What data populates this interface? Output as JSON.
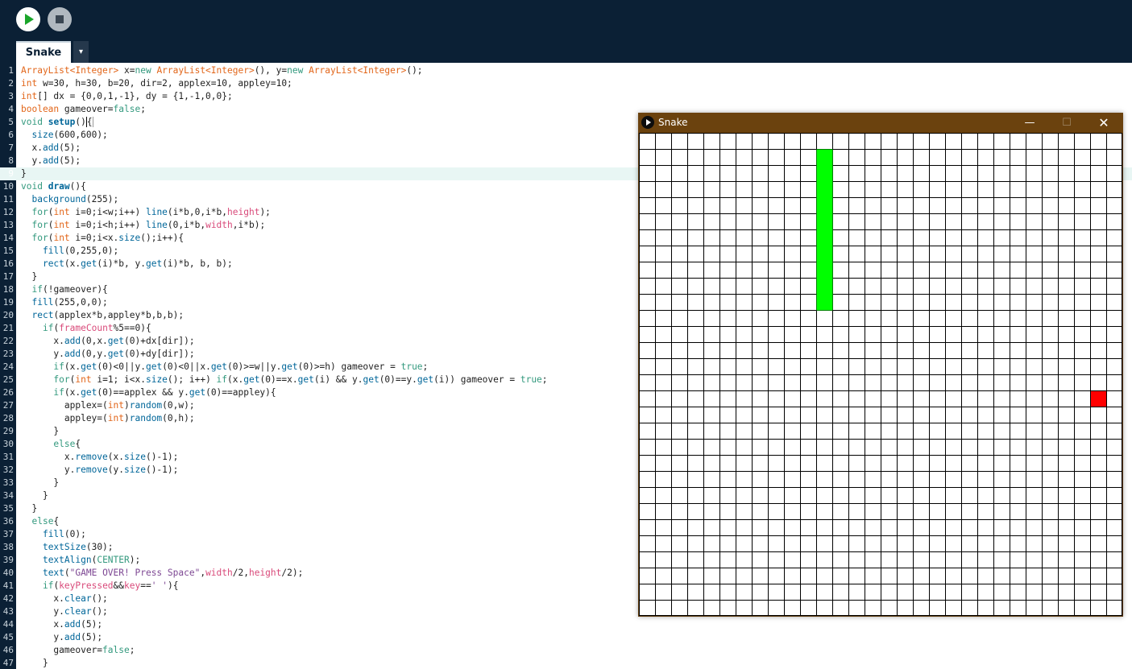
{
  "toolbar": {
    "run_icon": "play-icon",
    "stop_icon": "stop-icon"
  },
  "tabs": {
    "active": "Snake",
    "menu_glyph": "▾"
  },
  "editor": {
    "active_line": 9,
    "lines": [
      [
        [
          "ty",
          "ArrayList<Integer>"
        ],
        [
          "t",
          " x="
        ],
        [
          "kw",
          "new"
        ],
        [
          "t",
          " "
        ],
        [
          "ty",
          "ArrayList<Integer>"
        ],
        [
          "t",
          "(), y="
        ],
        [
          "kw",
          "new"
        ],
        [
          "t",
          " "
        ],
        [
          "ty",
          "ArrayList<Integer>"
        ],
        [
          "t",
          "();"
        ]
      ],
      [
        [
          "ty",
          "int"
        ],
        [
          "t",
          " w=30, h=30, b=20, dir=2, applex=10, appley=10;"
        ]
      ],
      [
        [
          "ty",
          "int"
        ],
        [
          "t",
          "[] dx = {0,0,1,-1}, dy = {1,-1,0,0};"
        ]
      ],
      [
        [
          "ty",
          "boolean"
        ],
        [
          "t",
          " gameover="
        ],
        [
          "kw",
          "false"
        ],
        [
          "t",
          ";"
        ]
      ],
      [
        [
          "kw",
          "void"
        ],
        [
          "t",
          " "
        ],
        [
          "fnb",
          "setup"
        ],
        [
          "t",
          "()"
        ],
        [
          "cur",
          "{"
        ]
      ],
      [
        [
          "t",
          "  "
        ],
        [
          "fn",
          "size"
        ],
        [
          "t",
          "(600,600);"
        ]
      ],
      [
        [
          "t",
          "  x."
        ],
        [
          "fn",
          "add"
        ],
        [
          "t",
          "(5);"
        ]
      ],
      [
        [
          "t",
          "  y."
        ],
        [
          "fn",
          "add"
        ],
        [
          "t",
          "(5);"
        ]
      ],
      [
        [
          "t",
          "}"
        ]
      ],
      [
        [
          "kw",
          "void"
        ],
        [
          "t",
          " "
        ],
        [
          "fnb",
          "draw"
        ],
        [
          "t",
          "(){"
        ]
      ],
      [
        [
          "t",
          "  "
        ],
        [
          "fn",
          "background"
        ],
        [
          "t",
          "(255);"
        ]
      ],
      [
        [
          "t",
          "  "
        ],
        [
          "kw",
          "for"
        ],
        [
          "t",
          "("
        ],
        [
          "ty",
          "int"
        ],
        [
          "t",
          " i=0;i<w;i++) "
        ],
        [
          "fn",
          "line"
        ],
        [
          "t",
          "(i*b,0,i*b,"
        ],
        [
          "cn",
          "height"
        ],
        [
          "t",
          ");"
        ]
      ],
      [
        [
          "t",
          "  "
        ],
        [
          "kw",
          "for"
        ],
        [
          "t",
          "("
        ],
        [
          "ty",
          "int"
        ],
        [
          "t",
          " i=0;i<h;i++) "
        ],
        [
          "fn",
          "line"
        ],
        [
          "t",
          "(0,i*b,"
        ],
        [
          "cn",
          "width"
        ],
        [
          "t",
          ",i*b);"
        ]
      ],
      [
        [
          "t",
          "  "
        ],
        [
          "kw",
          "for"
        ],
        [
          "t",
          "("
        ],
        [
          "ty",
          "int"
        ],
        [
          "t",
          " i=0;i<x."
        ],
        [
          "fn",
          "size"
        ],
        [
          "t",
          "();i++){"
        ]
      ],
      [
        [
          "t",
          "    "
        ],
        [
          "fn",
          "fill"
        ],
        [
          "t",
          "(0,255,0);"
        ]
      ],
      [
        [
          "t",
          "    "
        ],
        [
          "fn",
          "rect"
        ],
        [
          "t",
          "(x."
        ],
        [
          "fn",
          "get"
        ],
        [
          "t",
          "(i)*b, y."
        ],
        [
          "fn",
          "get"
        ],
        [
          "t",
          "(i)*b, b, b);"
        ]
      ],
      [
        [
          "t",
          "  }"
        ]
      ],
      [
        [
          "t",
          "  "
        ],
        [
          "kw",
          "if"
        ],
        [
          "t",
          "(!gameover){"
        ]
      ],
      [
        [
          "t",
          "  "
        ],
        [
          "fn",
          "fill"
        ],
        [
          "t",
          "(255,0,0);"
        ]
      ],
      [
        [
          "t",
          "  "
        ],
        [
          "fn",
          "rect"
        ],
        [
          "t",
          "(applex*b,appley*b,b,b);"
        ]
      ],
      [
        [
          "t",
          "    "
        ],
        [
          "kw",
          "if"
        ],
        [
          "t",
          "("
        ],
        [
          "cn",
          "frameCount"
        ],
        [
          "t",
          "%5==0){"
        ]
      ],
      [
        [
          "t",
          "      x."
        ],
        [
          "fn",
          "add"
        ],
        [
          "t",
          "(0,x."
        ],
        [
          "fn",
          "get"
        ],
        [
          "t",
          "(0)+dx[dir]);"
        ]
      ],
      [
        [
          "t",
          "      y."
        ],
        [
          "fn",
          "add"
        ],
        [
          "t",
          "(0,y."
        ],
        [
          "fn",
          "get"
        ],
        [
          "t",
          "(0)+dy[dir]);"
        ]
      ],
      [
        [
          "t",
          "      "
        ],
        [
          "kw",
          "if"
        ],
        [
          "t",
          "(x."
        ],
        [
          "fn",
          "get"
        ],
        [
          "t",
          "(0)<0||y."
        ],
        [
          "fn",
          "get"
        ],
        [
          "t",
          "(0)<0||x."
        ],
        [
          "fn",
          "get"
        ],
        [
          "t",
          "(0)>=w||y."
        ],
        [
          "fn",
          "get"
        ],
        [
          "t",
          "(0)>=h) gameover = "
        ],
        [
          "kw",
          "true"
        ],
        [
          "t",
          ";"
        ]
      ],
      [
        [
          "t",
          "      "
        ],
        [
          "kw",
          "for"
        ],
        [
          "t",
          "("
        ],
        [
          "ty",
          "int"
        ],
        [
          "t",
          " i=1; i<x."
        ],
        [
          "fn",
          "size"
        ],
        [
          "t",
          "(); i++) "
        ],
        [
          "kw",
          "if"
        ],
        [
          "t",
          "(x."
        ],
        [
          "fn",
          "get"
        ],
        [
          "t",
          "(0)==x."
        ],
        [
          "fn",
          "get"
        ],
        [
          "t",
          "(i) && y."
        ],
        [
          "fn",
          "get"
        ],
        [
          "t",
          "(0)==y."
        ],
        [
          "fn",
          "get"
        ],
        [
          "t",
          "(i)) gameover = "
        ],
        [
          "kw",
          "true"
        ],
        [
          "t",
          ";"
        ]
      ],
      [
        [
          "t",
          "      "
        ],
        [
          "kw",
          "if"
        ],
        [
          "t",
          "(x."
        ],
        [
          "fn",
          "get"
        ],
        [
          "t",
          "(0)==applex && y."
        ],
        [
          "fn",
          "get"
        ],
        [
          "t",
          "(0)==appley){"
        ]
      ],
      [
        [
          "t",
          "        applex=("
        ],
        [
          "ty",
          "int"
        ],
        [
          "t",
          ")"
        ],
        [
          "fn",
          "random"
        ],
        [
          "t",
          "(0,w);"
        ]
      ],
      [
        [
          "t",
          "        appley=("
        ],
        [
          "ty",
          "int"
        ],
        [
          "t",
          ")"
        ],
        [
          "fn",
          "random"
        ],
        [
          "t",
          "(0,h);"
        ]
      ],
      [
        [
          "t",
          "      }"
        ]
      ],
      [
        [
          "t",
          "      "
        ],
        [
          "kw",
          "else"
        ],
        [
          "t",
          "{"
        ]
      ],
      [
        [
          "t",
          "        x."
        ],
        [
          "fn",
          "remove"
        ],
        [
          "t",
          "(x."
        ],
        [
          "fn",
          "size"
        ],
        [
          "t",
          "()-1);"
        ]
      ],
      [
        [
          "t",
          "        y."
        ],
        [
          "fn",
          "remove"
        ],
        [
          "t",
          "(y."
        ],
        [
          "fn",
          "size"
        ],
        [
          "t",
          "()-1);"
        ]
      ],
      [
        [
          "t",
          "      }"
        ]
      ],
      [
        [
          "t",
          "    }"
        ]
      ],
      [
        [
          "t",
          "  }"
        ]
      ],
      [
        [
          "t",
          "  "
        ],
        [
          "kw",
          "else"
        ],
        [
          "t",
          "{"
        ]
      ],
      [
        [
          "t",
          "    "
        ],
        [
          "fn",
          "fill"
        ],
        [
          "t",
          "(0);"
        ]
      ],
      [
        [
          "t",
          "    "
        ],
        [
          "fn",
          "textSize"
        ],
        [
          "t",
          "(30);"
        ]
      ],
      [
        [
          "t",
          "    "
        ],
        [
          "fn",
          "textAlign"
        ],
        [
          "t",
          "("
        ],
        [
          "kw",
          "CENTER"
        ],
        [
          "t",
          ");"
        ]
      ],
      [
        [
          "t",
          "    "
        ],
        [
          "fn",
          "text"
        ],
        [
          "t",
          "("
        ],
        [
          "st",
          "\"GAME OVER! Press Space\""
        ],
        [
          "t",
          ","
        ],
        [
          "cn",
          "width"
        ],
        [
          "t",
          "/2,"
        ],
        [
          "cn",
          "height"
        ],
        [
          "t",
          "/2);"
        ]
      ],
      [
        [
          "t",
          "    "
        ],
        [
          "kw",
          "if"
        ],
        [
          "t",
          "("
        ],
        [
          "cn",
          "keyPressed"
        ],
        [
          "t",
          "&&"
        ],
        [
          "cn",
          "key"
        ],
        [
          "t",
          "=="
        ],
        [
          "st",
          "' '"
        ],
        [
          "t",
          "){"
        ]
      ],
      [
        [
          "t",
          "      x."
        ],
        [
          "fn",
          "clear"
        ],
        [
          "t",
          "();"
        ]
      ],
      [
        [
          "t",
          "      y."
        ],
        [
          "fn",
          "clear"
        ],
        [
          "t",
          "();"
        ]
      ],
      [
        [
          "t",
          "      x."
        ],
        [
          "fn",
          "add"
        ],
        [
          "t",
          "(5);"
        ]
      ],
      [
        [
          "t",
          "      y."
        ],
        [
          "fn",
          "add"
        ],
        [
          "t",
          "(5);"
        ]
      ],
      [
        [
          "t",
          "      gameover="
        ],
        [
          "kw",
          "false"
        ],
        [
          "t",
          ";"
        ]
      ],
      [
        [
          "t",
          "    }"
        ]
      ]
    ]
  },
  "sketch_window": {
    "title": "Snake",
    "icon": "processing-play-icon",
    "controls": {
      "minimize": "—",
      "maximize": "☐",
      "close": "✕"
    },
    "grid": {
      "cols": 30,
      "rows": 30
    },
    "snake_cells": [
      [
        11,
        1
      ],
      [
        11,
        2
      ],
      [
        11,
        3
      ],
      [
        11,
        4
      ],
      [
        11,
        5
      ],
      [
        11,
        6
      ],
      [
        11,
        7
      ],
      [
        11,
        8
      ],
      [
        11,
        9
      ],
      [
        11,
        10
      ]
    ],
    "apple_cell": [
      28,
      16
    ],
    "colors": {
      "snake": "#00ff00",
      "apple": "#ff0000",
      "grid": "#000000",
      "background": "#ffffff"
    }
  }
}
